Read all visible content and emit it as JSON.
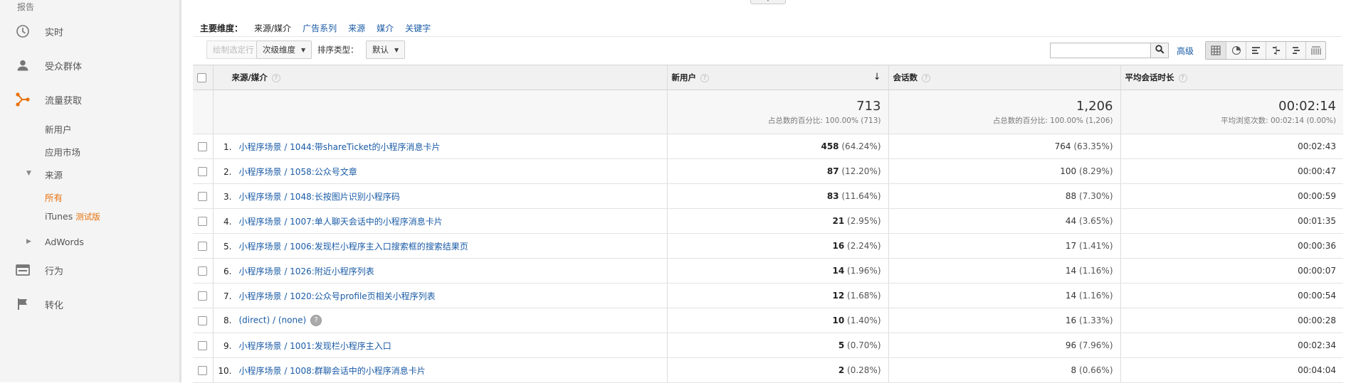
{
  "sidebar": {
    "section_label": "报告",
    "items": [
      {
        "label": "实时",
        "icon": "clock-icon"
      },
      {
        "label": "受众群体",
        "icon": "person-icon"
      },
      {
        "label": "流量获取",
        "icon": "acquisition-icon"
      },
      {
        "label": "行为",
        "icon": "behavior-icon"
      },
      {
        "label": "转化",
        "icon": "flag-icon"
      }
    ],
    "acquisition_sub": {
      "new_users": "新用户",
      "app_market": "应用市场",
      "source": "来源",
      "all": "所有",
      "itunes": "iTunes",
      "itunes_beta": "测试版",
      "adwords": "AdWords"
    }
  },
  "dimensions": {
    "label": "主要维度：",
    "current": "来源/媒介",
    "links": [
      "广告系列",
      "来源",
      "媒介",
      "关键字"
    ]
  },
  "toolbar": {
    "plot_rows": "绘制选定行",
    "secondary_dim": "次级维度",
    "sort_type_label": "排序类型：",
    "sort_default": "默认",
    "search_placeholder": "",
    "advanced": "高级",
    "view_icons": [
      "table-view-icon",
      "pie-view-icon",
      "performance-view-icon",
      "comparison-view-icon",
      "term-cloud-icon",
      "pivot-view-icon"
    ]
  },
  "table": {
    "headers": {
      "source_medium": "来源/媒介",
      "new_users": "新用户",
      "sessions": "会话数",
      "avg_duration": "平均会话时长"
    },
    "totals": {
      "new_users": "713",
      "new_users_sub": "占总数的百分比: 100.00% (713)",
      "sessions": "1,206",
      "sessions_sub": "占总数的百分比: 100.00% (1,206)",
      "avg_duration": "00:02:14",
      "avg_duration_sub": "平均浏览次数: 00:02:14 (0.00%)"
    },
    "rows": [
      {
        "rank": "1.",
        "name": "小程序场景 / 1044:带shareTicket的小程序消息卡片",
        "new_users": "458",
        "new_users_pct": "(64.24%)",
        "sessions": "764",
        "sessions_pct": "(63.35%)",
        "duration": "00:02:43"
      },
      {
        "rank": "2.",
        "name": "小程序场景 / 1058:公众号文章",
        "new_users": "87",
        "new_users_pct": "(12.20%)",
        "sessions": "100",
        "sessions_pct": "(8.29%)",
        "duration": "00:00:47"
      },
      {
        "rank": "3.",
        "name": "小程序场景 / 1048:长按图片识别小程序码",
        "new_users": "83",
        "new_users_pct": "(11.64%)",
        "sessions": "88",
        "sessions_pct": "(7.30%)",
        "duration": "00:00:59"
      },
      {
        "rank": "4.",
        "name": "小程序场景 / 1007:单人聊天会话中的小程序消息卡片",
        "new_users": "21",
        "new_users_pct": "(2.95%)",
        "sessions": "44",
        "sessions_pct": "(3.65%)",
        "duration": "00:01:35"
      },
      {
        "rank": "5.",
        "name": "小程序场景 / 1006:发现栏小程序主入口搜索框的搜索结果页",
        "new_users": "16",
        "new_users_pct": "(2.24%)",
        "sessions": "17",
        "sessions_pct": "(1.41%)",
        "duration": "00:00:36"
      },
      {
        "rank": "6.",
        "name": "小程序场景 / 1026:附近小程序列表",
        "new_users": "14",
        "new_users_pct": "(1.96%)",
        "sessions": "14",
        "sessions_pct": "(1.16%)",
        "duration": "00:00:07"
      },
      {
        "rank": "7.",
        "name": "小程序场景 / 1020:公众号profile页相关小程序列表",
        "new_users": "12",
        "new_users_pct": "(1.68%)",
        "sessions": "14",
        "sessions_pct": "(1.16%)",
        "duration": "00:00:54"
      },
      {
        "rank": "8.",
        "name": "(direct) / (none)",
        "new_users": "10",
        "new_users_pct": "(1.40%)",
        "sessions": "16",
        "sessions_pct": "(1.33%)",
        "duration": "00:00:28",
        "help": "?"
      },
      {
        "rank": "9.",
        "name": "小程序场景 / 1001:发现栏小程序主入口",
        "new_users": "5",
        "new_users_pct": "(0.70%)",
        "sessions": "96",
        "sessions_pct": "(7.96%)",
        "duration": "00:02:34"
      },
      {
        "rank": "10.",
        "name": "小程序场景 / 1008:群聊会话中的小程序消息卡片",
        "new_users": "2",
        "new_users_pct": "(0.28%)",
        "sessions": "8",
        "sessions_pct": "(0.66%)",
        "duration": "00:04:04"
      }
    ]
  },
  "colors": {
    "accent": "#e8710a",
    "link": "#1a5ba6"
  }
}
